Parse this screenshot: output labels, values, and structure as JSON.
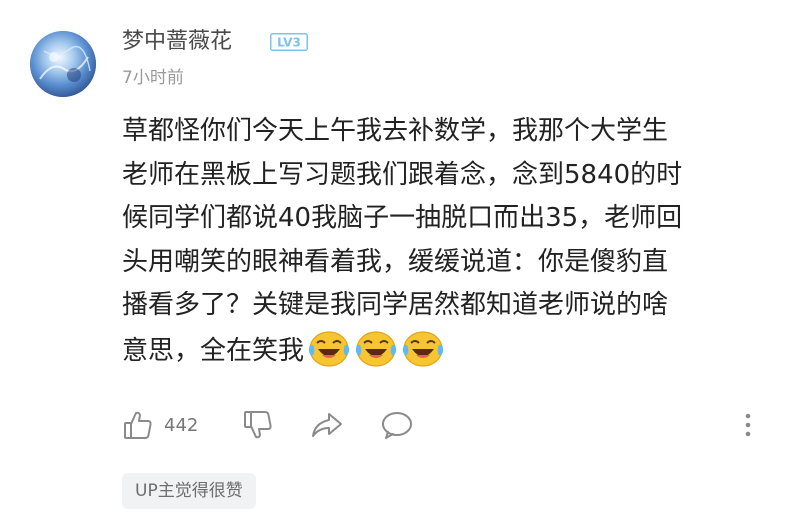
{
  "comment": {
    "username": "梦中蔷薇花",
    "level": "LV3",
    "time": "7小时前",
    "content_lines": [
      "草都怪你们今天上午我去补数学，我那个大学生",
      "老师在黑板上写习题我们跟着念，念到5840的时",
      "候同学们都说40我脑子一抽脱口而出35，老师回",
      "头用嘲笑的眼神看着我，缓缓说道：你是傻豹直",
      "播看多了？关键是我同学居然都知道老师说的啥",
      "意思，全在笑我"
    ],
    "emoji": [
      "laugh-cry-emoji",
      "laugh-cry-emoji",
      "laugh-cry-emoji"
    ],
    "likes": "442",
    "up_tag": "UP主觉得很赞"
  },
  "colors": {
    "username": "#4a4a4a",
    "level_badge": "#7ec4e8",
    "text": "#222222",
    "muted": "#9a9a9a",
    "icon": "#8a8a8a",
    "tag_bg": "#f1f2f3"
  },
  "icons": {
    "like": "thumb-up-icon",
    "dislike": "thumb-down-icon",
    "share": "share-icon",
    "reply": "comment-bubble-icon",
    "more": "more-vertical-icon"
  }
}
